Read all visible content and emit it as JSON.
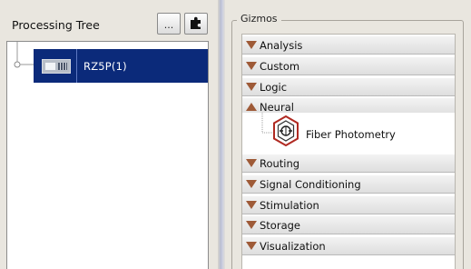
{
  "processing_tree": {
    "title": "Processing Tree",
    "browse_button": "...",
    "node_label": "RZ5P(1)",
    "icons": {
      "add": "puzzle-piece-icon",
      "device": "rz-device-icon"
    }
  },
  "gizmos": {
    "legend": "Gizmos",
    "categories": [
      {
        "label": "Analysis",
        "state": "collapsed"
      },
      {
        "label": "Custom",
        "state": "collapsed"
      },
      {
        "label": "Logic",
        "state": "collapsed"
      },
      {
        "label": "Neural",
        "state": "expanded"
      },
      {
        "label": "Routing",
        "state": "collapsed"
      },
      {
        "label": "Signal Conditioning",
        "state": "collapsed"
      },
      {
        "label": "Stimulation",
        "state": "collapsed"
      },
      {
        "label": "Storage",
        "state": "collapsed"
      },
      {
        "label": "Visualization",
        "state": "collapsed"
      }
    ],
    "neural_items": [
      {
        "label": "Fiber Photometry",
        "icon": "fiber-photometry-icon"
      }
    ]
  },
  "colors": {
    "selection": "#0b2a7a",
    "triangle": "#9e5a37",
    "gizmo_hex": "#b02a22"
  }
}
